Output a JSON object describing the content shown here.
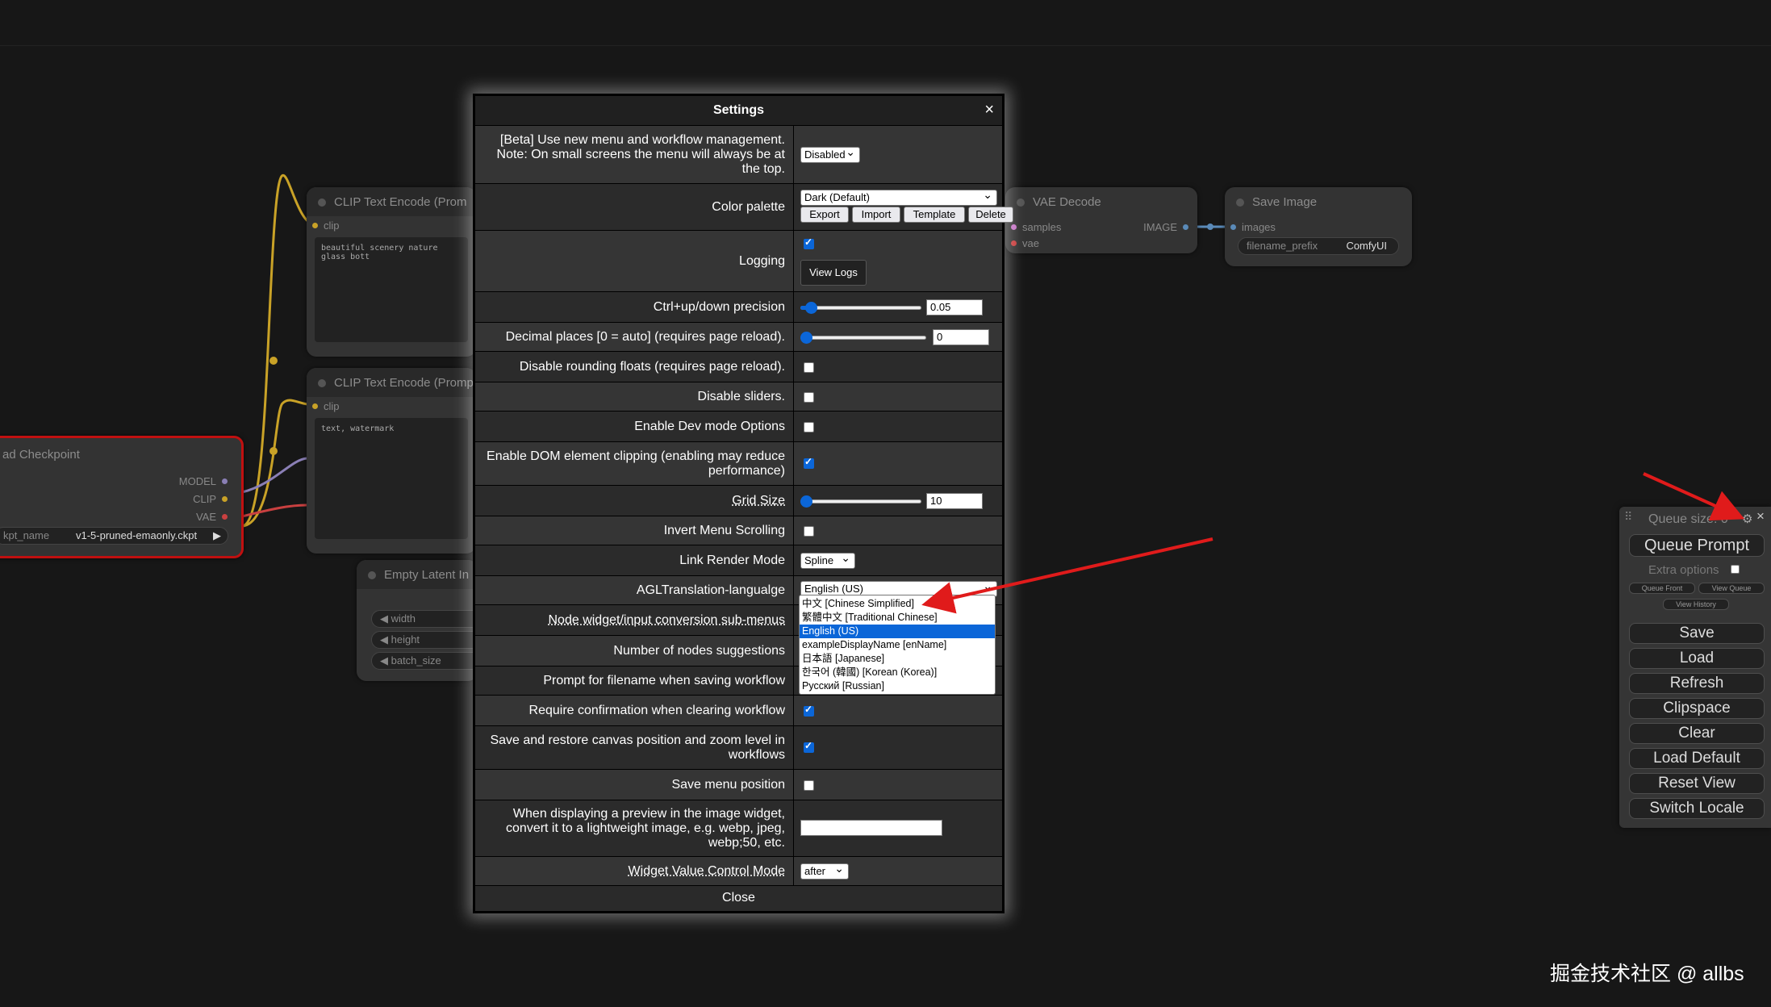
{
  "background_nodes": {
    "clip_text_encode_1": {
      "title": "CLIP Text Encode (Prom",
      "input": "clip",
      "text": "beautiful scenery nature glass bott"
    },
    "clip_text_encode_2": {
      "title": "CLIP Text Encode (Promp",
      "input": "clip",
      "text": "text, watermark"
    },
    "load_checkpoint": {
      "title": "ad Checkpoint",
      "outputs": [
        "MODEL",
        "CLIP",
        "VAE"
      ],
      "widget_name": "kpt_name",
      "widget_value": "v1-5-pruned-emaonly.ckpt"
    },
    "empty_latent": {
      "title": "Empty Latent In",
      "widgets": [
        "width",
        "height",
        "batch_size"
      ]
    },
    "vae_decode": {
      "title": "VAE Decode",
      "inputs": [
        "samples",
        "vae"
      ],
      "output": "IMAGE"
    },
    "save_image": {
      "title": "Save Image",
      "input": "images",
      "widget_name": "filename_prefix",
      "widget_value": "ComfyUI"
    }
  },
  "settings": {
    "title": "Settings",
    "close_x": "×",
    "rows": [
      {
        "label": "[Beta] Use new menu and workflow management. Note: On small screens the menu will always be at the top.",
        "control": "select",
        "value": "Disabled"
      },
      {
        "label": "Color palette",
        "control": "select",
        "value": "Dark (Default)",
        "buttons": [
          "Export",
          "Import",
          "Template",
          "Delete"
        ]
      },
      {
        "label": "Logging",
        "control": "checkbox",
        "checked": true,
        "button": "View Logs"
      },
      {
        "label": "Ctrl+up/down precision",
        "control": "slider",
        "value": "0.05",
        "fraction": 0.08
      },
      {
        "label": "Decimal places [0 = auto] (requires page reload).",
        "control": "slider",
        "value": "0",
        "fraction": 0.0
      },
      {
        "label": "Disable rounding floats (requires page reload).",
        "control": "checkbox",
        "checked": false
      },
      {
        "label": "Disable sliders.",
        "control": "checkbox",
        "checked": false
      },
      {
        "label": "Enable Dev mode Options",
        "control": "checkbox",
        "checked": false
      },
      {
        "label": "Enable DOM element clipping (enabling may reduce performance)",
        "control": "checkbox",
        "checked": true
      },
      {
        "label": "Grid Size",
        "control": "slider",
        "value": "10",
        "fraction": 0.0
      },
      {
        "label": "Invert Menu Scrolling",
        "control": "checkbox",
        "checked": false
      },
      {
        "label": "Link Render Mode",
        "control": "select",
        "value": "Spline"
      },
      {
        "label": "AGLTranslation-langualge",
        "control": "select",
        "value": "English (US)"
      },
      {
        "label": "Node widget/input conversion sub-menus",
        "control": "none"
      },
      {
        "label": "Number of nodes suggestions",
        "control": "none"
      },
      {
        "label": "Prompt for filename when saving workflow",
        "control": "none"
      },
      {
        "label": "Require confirmation when clearing workflow",
        "control": "checkbox",
        "checked": true
      },
      {
        "label": "Save and restore canvas position and zoom level in workflows",
        "control": "checkbox",
        "checked": true
      },
      {
        "label": "Save menu position",
        "control": "checkbox",
        "checked": false
      },
      {
        "label": "When displaying a preview in the image widget, convert it to a lightweight image, e.g. webp, jpeg, webp;50, etc.",
        "control": "text",
        "value": ""
      },
      {
        "label": "Widget Value Control Mode",
        "control": "select",
        "value": "after"
      }
    ],
    "close_button": "Close"
  },
  "language_dropdown": {
    "options": [
      "中文 [Chinese Simplified]",
      "繁體中文 [Traditional Chinese]",
      "English (US)",
      "exampleDisplayName [enName]",
      "日本語 [Japanese]",
      "한국어 (韓國) [Korean (Korea)]",
      "Русский [Russian]"
    ],
    "selected": "English (US)"
  },
  "side_menu": {
    "queue_size": "Queue size: 0",
    "queue_prompt": "Queue Prompt",
    "extra_options": "Extra options",
    "queue_front": "Queue Front",
    "view_queue": "View Queue",
    "view_history": "View History",
    "buttons": [
      "Save",
      "Load",
      "Refresh",
      "Clipspace",
      "Clear",
      "Load Default",
      "Reset View",
      "Switch Locale"
    ]
  },
  "watermark": "掘金技术社区 @ allbs",
  "colors": {
    "accent": "#0b66d8",
    "annotation_arrow": "#e01b1b",
    "clip_wire": "#c9a227",
    "vae_wire": "#c94040",
    "model_wire": "#8a7fb5"
  }
}
